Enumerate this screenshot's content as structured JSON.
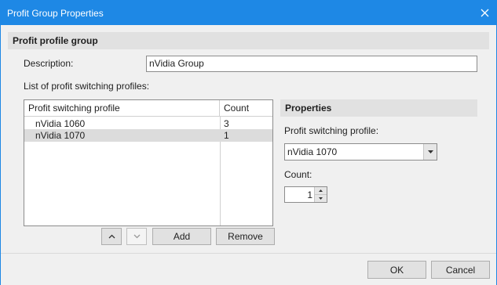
{
  "window": {
    "title": "Profit Group Properties"
  },
  "group": {
    "header": "Profit profile group",
    "description_label": "Description:",
    "description_value": "nVidia Group",
    "list_label": "List of profit switching profiles:"
  },
  "list": {
    "columns": [
      "Profit switching profile",
      "Count"
    ],
    "rows": [
      {
        "profile": "nVidia 1060",
        "count": "3",
        "selected": false
      },
      {
        "profile": "nVidia 1070",
        "count": "1",
        "selected": true
      }
    ]
  },
  "list_buttons": {
    "add": "Add",
    "remove": "Remove"
  },
  "properties": {
    "header": "Properties",
    "profile_label": "Profit switching profile:",
    "profile_value": "nVidia 1070",
    "count_label": "Count:",
    "count_value": "1"
  },
  "footer": {
    "ok": "OK",
    "cancel": "Cancel"
  },
  "colors": {
    "titlebar": "#1e88e5",
    "section": "#e1e1e1",
    "selection": "#dcdcdc"
  },
  "icons": [
    "close-icon",
    "move-up-icon",
    "move-down-icon",
    "dropdown-arrow-icon",
    "spin-up-icon",
    "spin-down-icon"
  ]
}
